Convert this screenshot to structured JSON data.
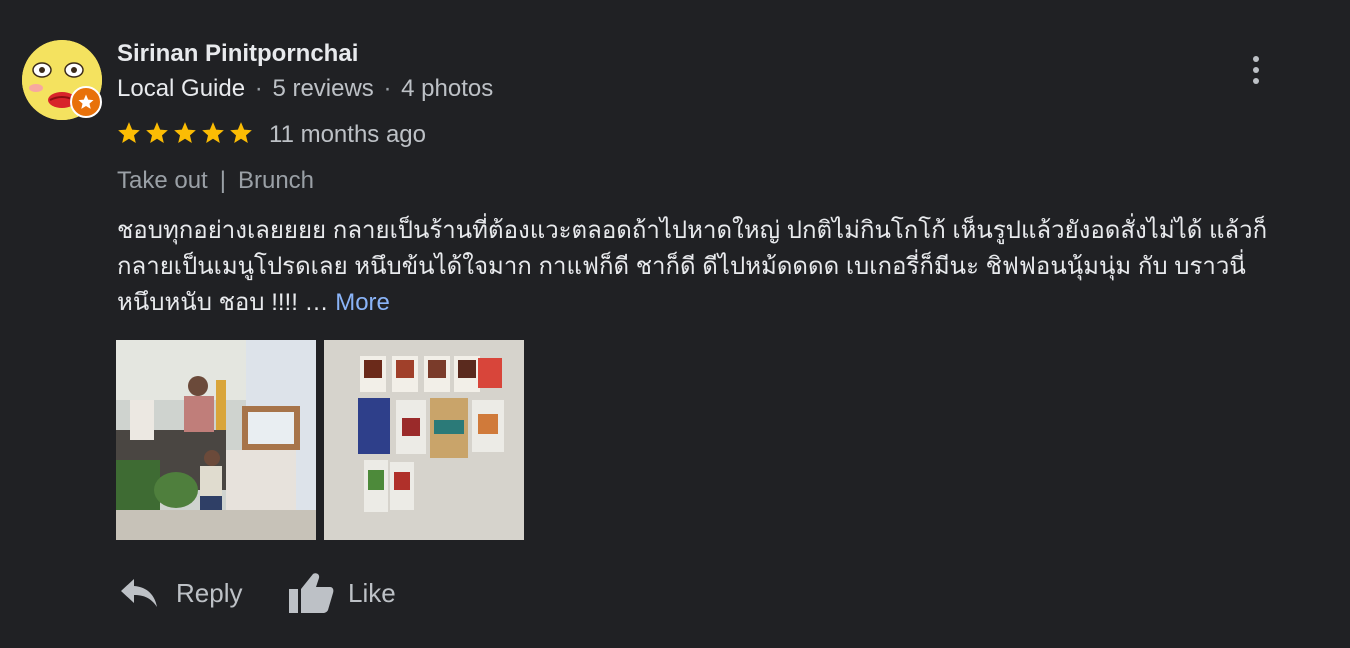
{
  "reviewer": {
    "name": "Sirinan Pinitpornchai",
    "badge": "Local Guide",
    "reviews": "5 reviews",
    "photos": "4 photos",
    "separator": "·"
  },
  "rating": {
    "stars": 5,
    "max_stars": 5,
    "time_ago": "11 months ago"
  },
  "tags": {
    "service": "Take out",
    "divider": "|",
    "meal": "Brunch"
  },
  "review_text": {
    "line1": "ชอบทุกอย่างเลยยยย กลายเป็นร้านที่ต้องแวะตลอดถ้าไปหาดใหญ่ ปกติไม่กินโกโก้ เห็นรูปแล้วยังอดสั่งไม่ได้ แล้วก็",
    "line2": "กลายเป็นเมนูโปรดเลย หนึบข้นได้ใจมาก กาแฟก็ดี ชาก็ดี ดีไปหม้ดดดด เบเกอรี่ก็มีนะ ชิฟฟอนนุ้มนุ่ม กับ บราวนี่",
    "line3": "หนึบหนับ ชอบ !!!! … ",
    "more": "More"
  },
  "photos": [
    {
      "icon": "coffee-shop-photo"
    },
    {
      "icon": "product-packages-photo"
    }
  ],
  "actions": {
    "reply": "Reply",
    "like": "Like"
  },
  "colors": {
    "background": "#202124",
    "star": "#fbbc04",
    "link": "#8ab4f8",
    "badge": "#e8710a"
  }
}
